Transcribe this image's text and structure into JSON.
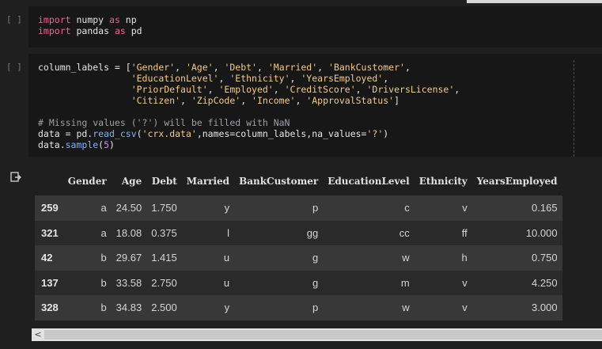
{
  "cell1": {
    "bracket": "[ ]",
    "lines": [
      [
        {
          "t": "import",
          "c": "kw"
        },
        {
          "t": " numpy ",
          "c": ""
        },
        {
          "t": "as",
          "c": "kw"
        },
        {
          "t": " np",
          "c": ""
        }
      ],
      [
        {
          "t": "import",
          "c": "kw"
        },
        {
          "t": " pandas ",
          "c": ""
        },
        {
          "t": "as",
          "c": "kw"
        },
        {
          "t": " pd",
          "c": ""
        }
      ]
    ]
  },
  "cell2": {
    "bracket": "[ ]",
    "lines": [
      [
        {
          "t": "column_labels = [",
          "c": ""
        },
        {
          "t": "'Gender'",
          "c": "str"
        },
        {
          "t": ", ",
          "c": ""
        },
        {
          "t": "'Age'",
          "c": "str"
        },
        {
          "t": ", ",
          "c": ""
        },
        {
          "t": "'Debt'",
          "c": "str"
        },
        {
          "t": ", ",
          "c": ""
        },
        {
          "t": "'Married'",
          "c": "str"
        },
        {
          "t": ", ",
          "c": ""
        },
        {
          "t": "'BankCustomer'",
          "c": "str"
        },
        {
          "t": ",",
          "c": ""
        }
      ],
      [
        {
          "t": "                 ",
          "c": ""
        },
        {
          "t": "'EducationLevel'",
          "c": "str"
        },
        {
          "t": ", ",
          "c": ""
        },
        {
          "t": "'Ethnicity'",
          "c": "str"
        },
        {
          "t": ", ",
          "c": ""
        },
        {
          "t": "'YearsEmployed'",
          "c": "str"
        },
        {
          "t": ",",
          "c": ""
        }
      ],
      [
        {
          "t": "                 ",
          "c": ""
        },
        {
          "t": "'PriorDefault'",
          "c": "str"
        },
        {
          "t": ", ",
          "c": ""
        },
        {
          "t": "'Employed'",
          "c": "str"
        },
        {
          "t": ", ",
          "c": ""
        },
        {
          "t": "'CreditScore'",
          "c": "str"
        },
        {
          "t": ", ",
          "c": ""
        },
        {
          "t": "'DriversLicense'",
          "c": "str"
        },
        {
          "t": ",",
          "c": ""
        }
      ],
      [
        {
          "t": "                 ",
          "c": ""
        },
        {
          "t": "'Citizen'",
          "c": "str"
        },
        {
          "t": ", ",
          "c": ""
        },
        {
          "t": "'ZipCode'",
          "c": "str"
        },
        {
          "t": ", ",
          "c": ""
        },
        {
          "t": "'Income'",
          "c": "str"
        },
        {
          "t": ", ",
          "c": ""
        },
        {
          "t": "'ApprovalStatus'",
          "c": "str"
        },
        {
          "t": "]",
          "c": ""
        }
      ],
      [
        {
          "t": "",
          "c": ""
        }
      ],
      [
        {
          "t": "# Missing values ('?') will be filled with NaN",
          "c": "cm"
        }
      ],
      [
        {
          "t": "data = pd.",
          "c": ""
        },
        {
          "t": "read_csv",
          "c": "fn"
        },
        {
          "t": "(",
          "c": ""
        },
        {
          "t": "'crx.data'",
          "c": "str"
        },
        {
          "t": ",names=column_labels,na_values=",
          "c": ""
        },
        {
          "t": "'?'",
          "c": "str"
        },
        {
          "t": ")",
          "c": ""
        }
      ],
      [
        {
          "t": "data.",
          "c": ""
        },
        {
          "t": "sample",
          "c": "fn"
        },
        {
          "t": "(",
          "c": ""
        },
        {
          "t": "5",
          "c": "num"
        },
        {
          "t": ")",
          "c": ""
        }
      ]
    ]
  },
  "output": {
    "icon": "output-icon",
    "columns": [
      "",
      "Gender",
      "Age",
      "Debt",
      "Married",
      "BankCustomer",
      "EducationLevel",
      "Ethnicity",
      "YearsEmployed"
    ],
    "rows": [
      [
        "259",
        "a",
        "24.50",
        "1.750",
        "y",
        "p",
        "c",
        "v",
        "0.165"
      ],
      [
        "321",
        "a",
        "18.08",
        "0.375",
        "l",
        "gg",
        "cc",
        "ff",
        "10.000"
      ],
      [
        "42",
        "b",
        "29.67",
        "1.415",
        "u",
        "g",
        "w",
        "h",
        "0.750"
      ],
      [
        "137",
        "b",
        "33.58",
        "2.750",
        "u",
        "g",
        "m",
        "v",
        "4.250"
      ],
      [
        "328",
        "b",
        "34.83",
        "2.500",
        "y",
        "p",
        "w",
        "v",
        "3.000"
      ]
    ],
    "scroll_left_glyph": "<"
  }
}
